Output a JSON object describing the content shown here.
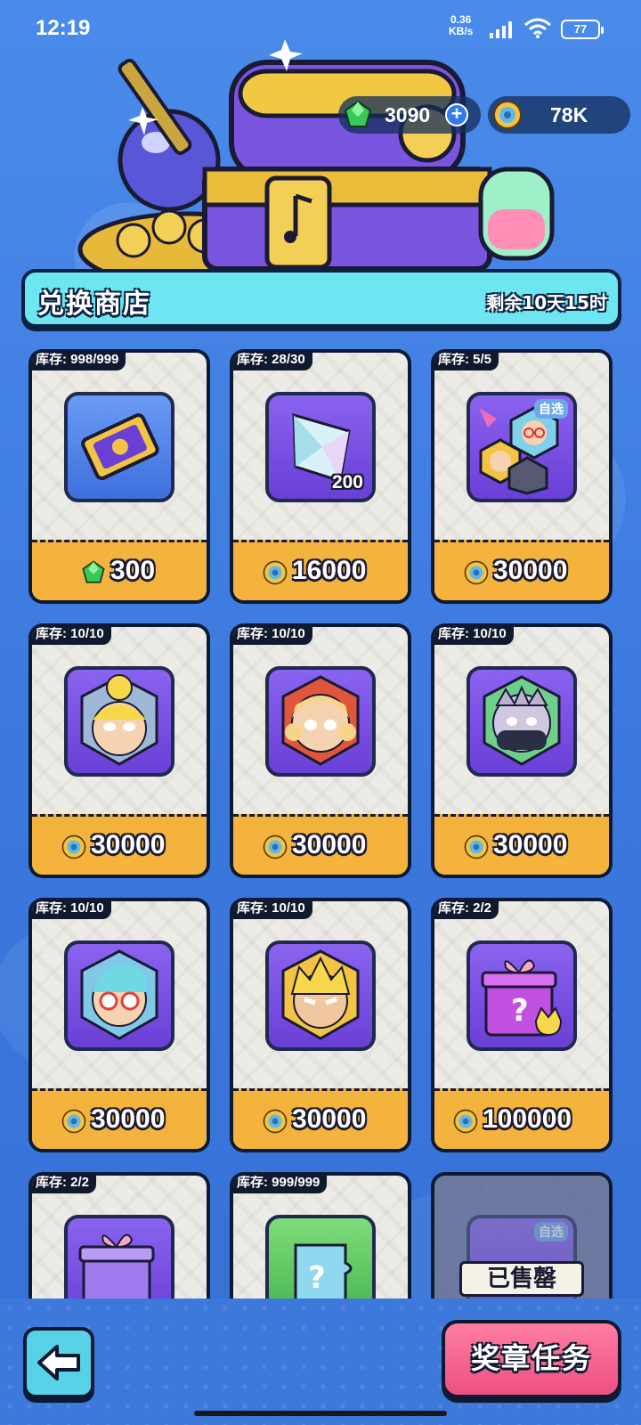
{
  "status_bar": {
    "time": "12:19",
    "net_speed_value": "0.36",
    "net_speed_unit": "KB/s",
    "battery": "77"
  },
  "currency": {
    "gems": "3090",
    "coins": "78K"
  },
  "shop": {
    "title": "兑换商店",
    "remaining": "剩余10天15时"
  },
  "items": [
    {
      "stock": "库存: 998/999",
      "icon": "ticket-icon",
      "bg": "blue",
      "price": "300",
      "currency_icon": "gem-icon"
    },
    {
      "stock": "库存: 28/30",
      "icon": "crystal-icon",
      "bg": "purple",
      "quantity": "200",
      "price": "16000",
      "currency_icon": "coin-icon"
    },
    {
      "stock": "库存: 5/5",
      "icon": "avatar-pack-icon",
      "bg": "purple",
      "tag": "自选",
      "price": "30000",
      "currency_icon": "coin-icon"
    },
    {
      "stock": "库存: 10/10",
      "icon": "blonde-bun-avatar-icon",
      "bg": "purple",
      "price": "30000",
      "currency_icon": "coin-icon"
    },
    {
      "stock": "库存: 10/10",
      "icon": "blonde-pigtails-avatar-icon",
      "bg": "purple",
      "price": "30000",
      "currency_icon": "coin-icon"
    },
    {
      "stock": "库存: 10/10",
      "icon": "ninja-avatar-icon",
      "bg": "purple",
      "price": "30000",
      "currency_icon": "coin-icon"
    },
    {
      "stock": "库存: 10/10",
      "icon": "glasses-avatar-icon",
      "bg": "purple",
      "price": "30000",
      "currency_icon": "coin-icon"
    },
    {
      "stock": "库存: 10/10",
      "icon": "spiky-hair-avatar-icon",
      "bg": "purple",
      "price": "30000",
      "currency_icon": "coin-icon"
    },
    {
      "stock": "库存: 2/2",
      "icon": "mystery-gift-icon",
      "bg": "purple",
      "price": "100000",
      "currency_icon": "coin-icon"
    },
    {
      "stock": "库存: 2/2",
      "icon": "mystery-gift-icon",
      "bg": "purple"
    },
    {
      "stock": "库存: 999/999",
      "icon": "mystery-puzzle-icon",
      "bg": "green"
    },
    {
      "icon": "avatar-pack-icon",
      "tag": "自选",
      "sold_out": "已售罄"
    }
  ],
  "bottom": {
    "task_button": "奖章任务"
  },
  "colors": {
    "background": "#3f7de0",
    "title_bar": "#6ee6f2",
    "price_bar": "#f3b33d",
    "task_button": "#ee4f82",
    "back_button": "#58d2e6"
  }
}
